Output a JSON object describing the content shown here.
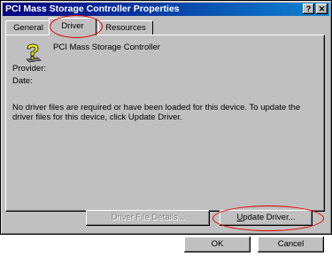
{
  "window": {
    "title": "PCI Mass Storage Controller Properties",
    "help_label": "?",
    "close_label": "✕"
  },
  "tabs": [
    {
      "label": "General",
      "active": false
    },
    {
      "label": "Driver",
      "active": true
    },
    {
      "label": "Resources",
      "active": false
    }
  ],
  "device": {
    "icon": "unknown-device-question-icon",
    "name": "PCI Mass Storage Controller"
  },
  "fields": {
    "provider_label": "Provider:",
    "date_label": "Date:"
  },
  "message": "No driver files are required or have been loaded for this device.  To update the driver files for this device, click Update Driver.",
  "buttons": {
    "driver_file_details": "Driver File Details...",
    "update_driver_mnemonic": "U",
    "update_driver_rest": "pdate Driver...",
    "ok": "OK",
    "cancel": "Cancel"
  },
  "colors": {
    "titlebar_start": "#000080",
    "titlebar_end": "#1084d0",
    "face": "#c0c0c0",
    "annotation": "#e00000"
  }
}
